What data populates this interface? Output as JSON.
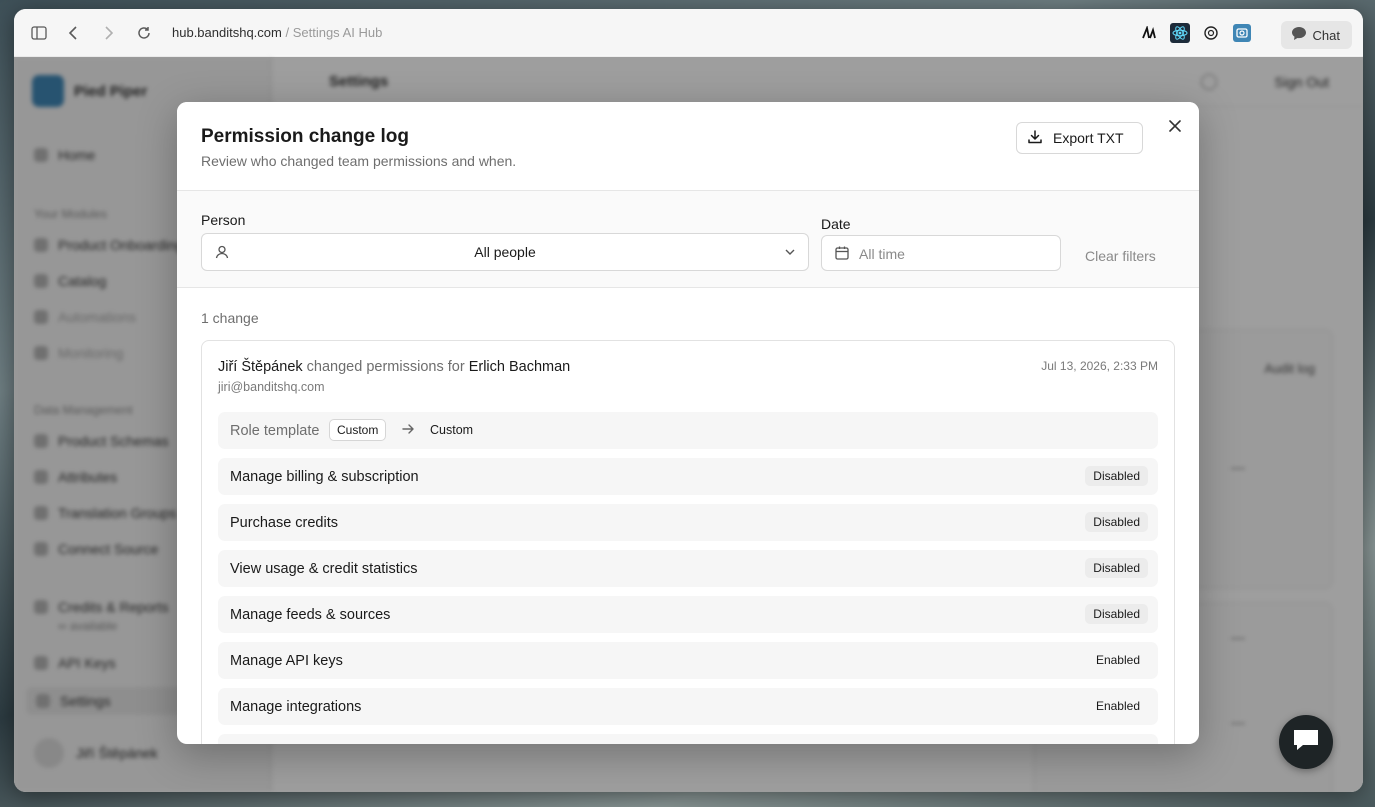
{
  "browser": {
    "url_host": "hub.banditshq.com",
    "url_crumb": "/ Settings AI Hub",
    "chat_label": "Chat"
  },
  "background": {
    "org_name": "Pied Piper",
    "page_title": "Settings",
    "sign_out": "Sign Out",
    "audit_log_col": "Audit log",
    "dash": "—",
    "sidebar": {
      "home": "Home",
      "section_modules": "Your Modules",
      "modules": [
        "Product Onboarding",
        "Catalog",
        "Automations",
        "Monitoring"
      ],
      "section_data": "Data Management",
      "data_items": [
        "Product Schemas",
        "Attributes",
        "Translation Groups",
        "Connect Source"
      ],
      "credits": "Credits & Reports",
      "credits_sub": "∞ available",
      "api_keys": "API Keys",
      "settings": "Settings",
      "user": "Jiří Štěpánek"
    }
  },
  "modal": {
    "title": "Permission change log",
    "subtitle": "Review who changed team permissions and when.",
    "export_label": "Export TXT",
    "filters": {
      "person_label": "Person",
      "person_value": "All people",
      "date_label": "Date",
      "date_placeholder": "All time",
      "clear_label": "Clear filters"
    },
    "count_text": "1 change",
    "entry": {
      "actor": "Jiří Štěpánek",
      "action": "changed permissions for",
      "target": "Erlich Bachman",
      "email": "jiri@banditshq.com",
      "timestamp": "Jul 13, 2026, 2:33 PM",
      "role_label": "Role template",
      "role_from": "Custom",
      "role_to": "Custom",
      "permissions": [
        {
          "name": "Manage billing & subscription",
          "status": "Disabled"
        },
        {
          "name": "Purchase credits",
          "status": "Disabled"
        },
        {
          "name": "View usage & credit statistics",
          "status": "Disabled"
        },
        {
          "name": "Manage feeds & sources",
          "status": "Disabled"
        },
        {
          "name": "Manage API keys",
          "status": "Enabled"
        },
        {
          "name": "Manage integrations",
          "status": "Enabled"
        }
      ]
    }
  },
  "colors": {
    "accent_logo": "#3f86b5",
    "fab_bg": "#1e2426",
    "disabled_pill": "#ececec"
  },
  "icons": {
    "sidebar_toggle": "sidebar-toggle-icon",
    "back": "back-icon",
    "forward": "forward-icon",
    "reload": "reload-icon",
    "download": "download-icon",
    "close": "close-icon",
    "user": "user-icon",
    "chevron": "chevron-down-icon",
    "calendar": "calendar-icon",
    "arrow": "arrow-right-icon",
    "chat": "chat-bubble-icon"
  }
}
